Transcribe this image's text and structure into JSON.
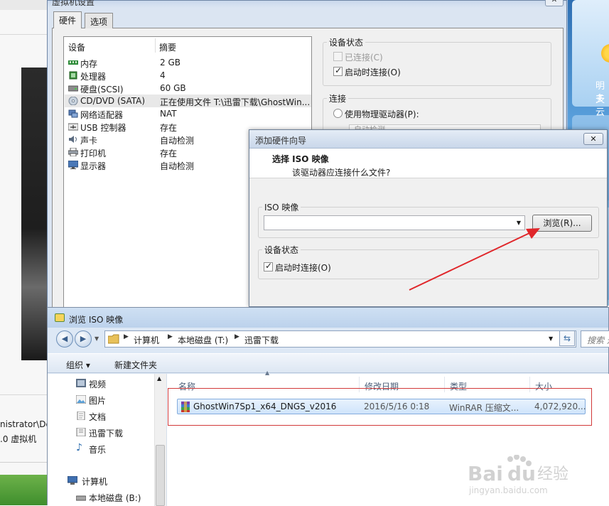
{
  "bg_app": {
    "path_text": "nistrator\\Dc",
    "vm_text": ".0 虚拟机"
  },
  "weather": {
    "line1": "明天",
    "line2": "多云"
  },
  "vm_settings": {
    "title": "虚拟机设置",
    "close": "✕",
    "tabs": [
      "硬件",
      "选项"
    ],
    "columns": {
      "device": "设备",
      "summary": "摘要"
    },
    "devices": [
      {
        "name": "内存",
        "summary": "2 GB"
      },
      {
        "name": "处理器",
        "summary": "4"
      },
      {
        "name": "硬盘(SCSI)",
        "summary": "60 GB"
      },
      {
        "name": "CD/DVD (SATA)",
        "summary": "正在使用文件 T:\\迅雷下载\\GhostWin..."
      },
      {
        "name": "网络适配器",
        "summary": "NAT"
      },
      {
        "name": "USB 控制器",
        "summary": "存在"
      },
      {
        "name": "声卡",
        "summary": "自动检测"
      },
      {
        "name": "打印机",
        "summary": "存在"
      },
      {
        "name": "显示器",
        "summary": "自动检测"
      }
    ],
    "device_status": {
      "label": "设备状态",
      "connected": "已连接(C)",
      "connect_on_start": "启动时连接(O)"
    },
    "connection": {
      "label": "连接",
      "use_physical": "使用物理驱动器(P):",
      "auto_detect": "自动检测"
    }
  },
  "wizard": {
    "title": "添加硬件向导",
    "close": "✕",
    "heading": "选择 ISO 映像",
    "subheading": "该驱动器应连接什么文件?",
    "iso_group": "ISO 映像",
    "iso_value": "",
    "browse_button": "浏览(R)...",
    "status_group": "设备状态",
    "connect_on_start": "启动时连接(O)"
  },
  "browse_dialog": {
    "title": "浏览 ISO 映像",
    "breadcrumbs": [
      "计算机",
      "本地磁盘 (T:)",
      "迅雷下载"
    ],
    "search_placeholder": "搜索 迅雷下载",
    "toolbar": {
      "organize": "组织 ▾",
      "new_folder": "新建文件夹"
    },
    "nav_items": [
      "视频",
      "图片",
      "文档",
      "迅雷下载",
      "音乐",
      "计算机",
      "本地磁盘 (B:)"
    ],
    "columns": [
      "名称",
      "修改日期",
      "类型",
      "大小"
    ],
    "files": [
      {
        "name": "GhostWin7Sp1_x64_DNGS_v2016",
        "modified": "2016/5/16 0:18",
        "type": "WinRAR 压缩文...",
        "size": "4,072,920..."
      }
    ]
  },
  "watermark": {
    "brand": "Bai du 经验",
    "url": "jingyan.baidu.com"
  },
  "colors": {
    "highlight_red": "#d23a3a",
    "arrow_red": "#e0262a",
    "selection_blue": "#cfe4fb",
    "window_frame": "#dbe5f2"
  }
}
